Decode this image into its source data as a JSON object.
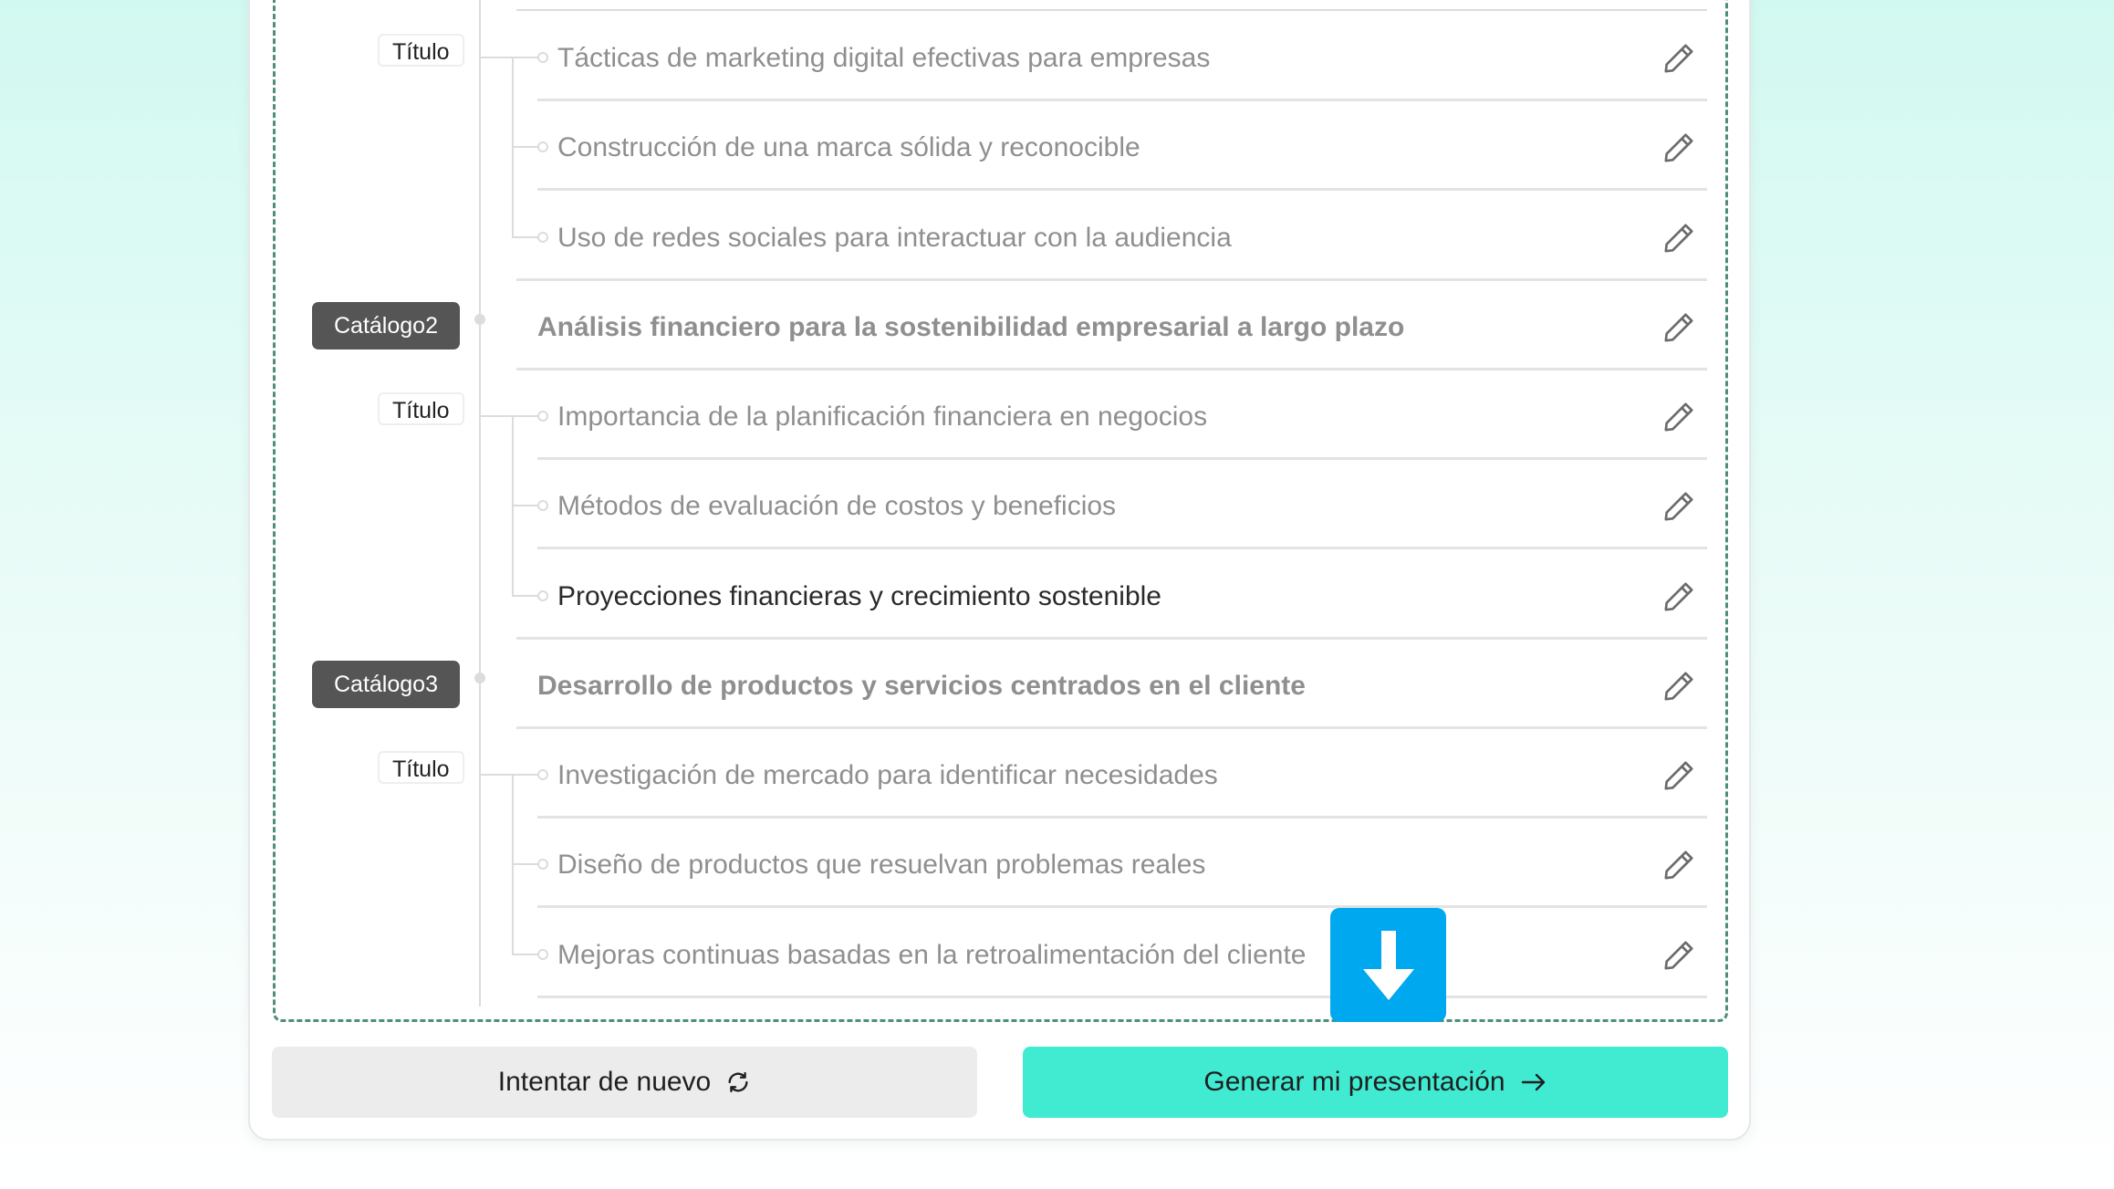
{
  "outline": {
    "rows": [
      {
        "text": "Tácticas de marketing digital efectivas para empresas",
        "kind": "subtitle"
      },
      {
        "text": "Construcción de una marca sólida y reconocible",
        "kind": "subtitle"
      },
      {
        "text": "Uso de redes sociales para interactuar con la audiencia",
        "kind": "subtitle"
      },
      {
        "text": "Análisis financiero para la sostenibilidad empresarial a largo plazo",
        "kind": "catalog"
      },
      {
        "text": "Importancia de la planificación financiera en negocios",
        "kind": "subtitle"
      },
      {
        "text": "Métodos de evaluación de costos y beneficios",
        "kind": "subtitle"
      },
      {
        "text": "Proyecciones financieras y crecimiento sostenible",
        "kind": "subtitle"
      },
      {
        "text": "Desarrollo de productos y servicios centrados en el cliente",
        "kind": "catalog"
      },
      {
        "text": "Investigación de mercado para identificar necesidades",
        "kind": "subtitle"
      },
      {
        "text": "Diseño de productos que resuelvan problemas reales",
        "kind": "subtitle"
      },
      {
        "text": "Mejoras continuas basadas en la retroalimentación del cliente",
        "kind": "subtitle"
      }
    ],
    "catalog_tags": [
      "Catálogo2",
      "Catálogo3"
    ],
    "title_tags": [
      "Título",
      "Título",
      "Título"
    ]
  },
  "buttons": {
    "retry_label": "Intentar de nuevo",
    "generate_label": "Generar mi presentación"
  },
  "icons": {
    "row_action": "pencil-icon",
    "retry": "refresh-icon",
    "generate": "arrow-right-icon",
    "overlay": "download-arrow-icon"
  },
  "colors": {
    "accent": "#40ebd2",
    "catalog_tag": "#555555",
    "download_button": "#00a8f0",
    "dashed_border": "#4f8d7c"
  }
}
